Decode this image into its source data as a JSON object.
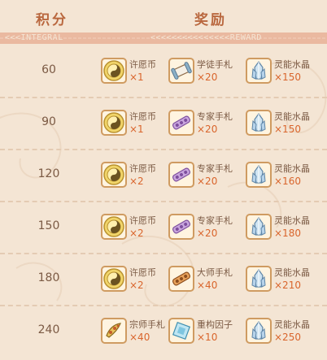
{
  "header": {
    "score_label": "积分",
    "reward_label": "奖励",
    "score_sub": "<<<INTEGRAL",
    "reward_sub": "<<<<<<<<<<<<<<<REWARD"
  },
  "rows": [
    {
      "score": "60",
      "items": [
        {
          "icon": "coin-icon",
          "name": "许愿币",
          "count": "×1"
        },
        {
          "icon": "scroll-icon",
          "name": "学徒手札",
          "count": "×20"
        },
        {
          "icon": "crystal-icon",
          "name": "灵能水晶",
          "count": "×150"
        }
      ]
    },
    {
      "score": "90",
      "items": [
        {
          "icon": "coin-icon",
          "name": "许愿币",
          "count": "×1"
        },
        {
          "icon": "purple-scroll-icon",
          "name": "专家手札",
          "count": "×20"
        },
        {
          "icon": "crystal-icon",
          "name": "灵能水晶",
          "count": "×150"
        }
      ]
    },
    {
      "score": "120",
      "items": [
        {
          "icon": "coin-icon",
          "name": "许愿币",
          "count": "×2"
        },
        {
          "icon": "purple-scroll-icon",
          "name": "专家手札",
          "count": "×20"
        },
        {
          "icon": "crystal-icon",
          "name": "灵能水晶",
          "count": "×160"
        }
      ]
    },
    {
      "score": "150",
      "items": [
        {
          "icon": "coin-icon",
          "name": "许愿币",
          "count": "×2"
        },
        {
          "icon": "purple-scroll-icon",
          "name": "专家手札",
          "count": "×20"
        },
        {
          "icon": "crystal-icon",
          "name": "灵能水晶",
          "count": "×180"
        }
      ]
    },
    {
      "score": "180",
      "items": [
        {
          "icon": "coin-icon",
          "name": "许愿币",
          "count": "×2"
        },
        {
          "icon": "orange-scroll-icon",
          "name": "大师手札",
          "count": "×40"
        },
        {
          "icon": "crystal-icon",
          "name": "灵能水晶",
          "count": "×210"
        }
      ]
    },
    {
      "score": "240",
      "items": [
        {
          "icon": "gold-scroll-icon",
          "name": "宗师手札",
          "count": "×40"
        },
        {
          "icon": "reconstruct-factor-icon",
          "name": "重构因子",
          "count": "×10"
        },
        {
          "icon": "crystal-icon",
          "name": "灵能水晶",
          "count": "×250"
        }
      ]
    }
  ],
  "colors": {
    "background": "#f4e5d4",
    "header_text": "#b9673e",
    "count_text": "#d9652c",
    "label_text": "#7b5a44",
    "strip": "#eab9a0"
  }
}
